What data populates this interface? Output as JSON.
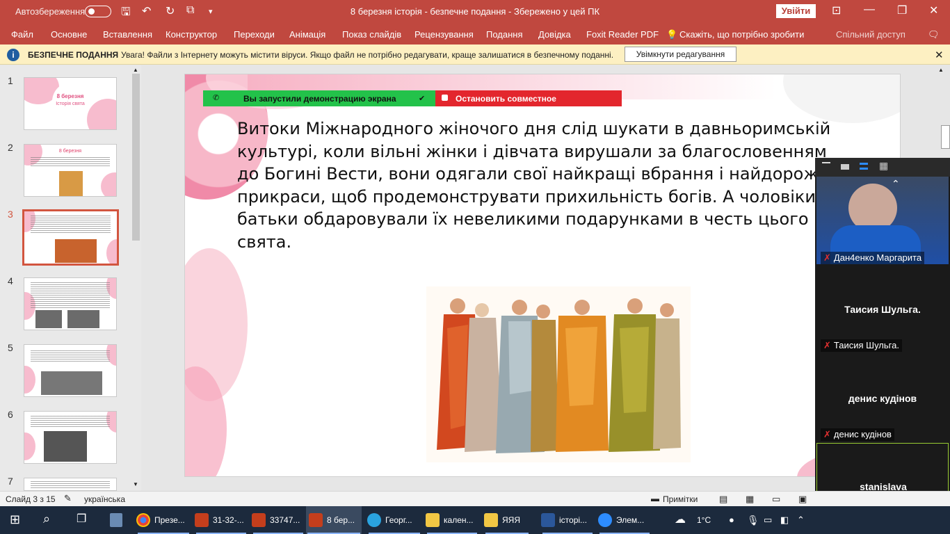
{
  "titlebar": {
    "autosave_label": "Автозбереження",
    "autosave_state": "off",
    "title": "8 березня історія  -  безпечне подання  -  Збережено у цей ПК",
    "signin_label": "Увійти"
  },
  "ribbon": {
    "tabs": [
      "Файл",
      "Основне",
      "Вставлення",
      "Конструктор",
      "Переходи",
      "Анімація",
      "Показ слайдів",
      "Рецензування",
      "Подання",
      "Довідка",
      "Foxit Reader PDF"
    ],
    "tellme": "Скажіть, що потрібно зробити",
    "share": "Спільний доступ"
  },
  "protected_view": {
    "title": "БЕЗПЕЧНЕ ПОДАННЯ",
    "message": "Увага! Файли з Інтернету можуть містити віруси. Якщо файл не потрібно редагувати, краще залишатися в безпечному поданні.",
    "enable_button": "Увімкнути редагування"
  },
  "slides_panel": {
    "numbers": [
      "1",
      "2",
      "3",
      "4",
      "5",
      "6",
      "7"
    ],
    "selected": 3,
    "thumb1_title": "8 березня",
    "thumb1_subtitle": "Історія свята",
    "thumb2_title": "8 березня"
  },
  "screen_share": {
    "notice": "Вы запустили демонстрацию экрана",
    "stop_label": "Остановить совместное использование"
  },
  "slide": {
    "text_lines": [
      "Витоки Міжнародного жіночого дня слід шукати в давньоримській",
      "культурі, коли вільні жінки і дівчата вирушали за благословенням",
      "до Богині Вести, вони одягали свої найкращі вбрання і найдорожчі",
      "прикраси, щоб продемонструвати прихильність богів. А чоловіки і",
      "батьки обдаровували їх невеликими подарунками в честь цього",
      "свята."
    ]
  },
  "zoom": {
    "participants": [
      {
        "label": "Дан4енко Маргарита"
      },
      {
        "big": "Таисия Шульга.",
        "label": "Таисия Шульга."
      },
      {
        "big": "денис кудінов",
        "label": "денис кудінов"
      },
      {
        "big": "stanislava",
        "label": "stanislava"
      }
    ]
  },
  "statusbar": {
    "slide_info": "Слайд 3 з 15",
    "language": "українська",
    "notes": "Примітки"
  },
  "taskbar": {
    "items": [
      "Презе...",
      "31-32-...",
      "33747...",
      "8 бер...",
      "Георг...",
      "кален...",
      "ЯЯЯ",
      "історі...",
      "Элем..."
    ],
    "weather": "1°C"
  },
  "colors": {
    "accent": "#c0483f",
    "share_green": "#23c24a",
    "share_red": "#e3262d",
    "selection": "#d2553f"
  }
}
